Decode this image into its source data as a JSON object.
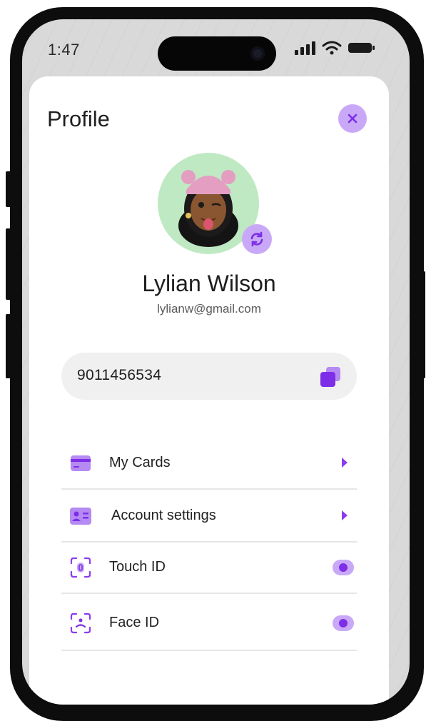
{
  "status_bar": {
    "time": "1:47"
  },
  "header": {
    "title": "Profile",
    "close_icon": "close-icon"
  },
  "profile": {
    "name": "Lylian Wilson",
    "email": "lylianw@gmail.com",
    "avatar": "memoji-avatar",
    "swap_icon": "refresh-icon"
  },
  "phone": {
    "number": "9011456534",
    "copy_icon": "copy-icon"
  },
  "menu": {
    "items": [
      {
        "label": "My Cards",
        "icon": "card-icon",
        "control": "arrow"
      },
      {
        "label": "Account settings",
        "icon": "id-card-icon",
        "control": "arrow"
      },
      {
        "label": "Touch ID",
        "icon": "fingerprint-icon",
        "control": "toggle",
        "enabled": true
      },
      {
        "label": "Face ID",
        "icon": "face-id-icon",
        "control": "toggle",
        "enabled": true
      }
    ]
  },
  "colors": {
    "accent": "#8b3cf0",
    "accent_light": "#c9a9f7",
    "avatar_bg": "#bfe9c3"
  }
}
